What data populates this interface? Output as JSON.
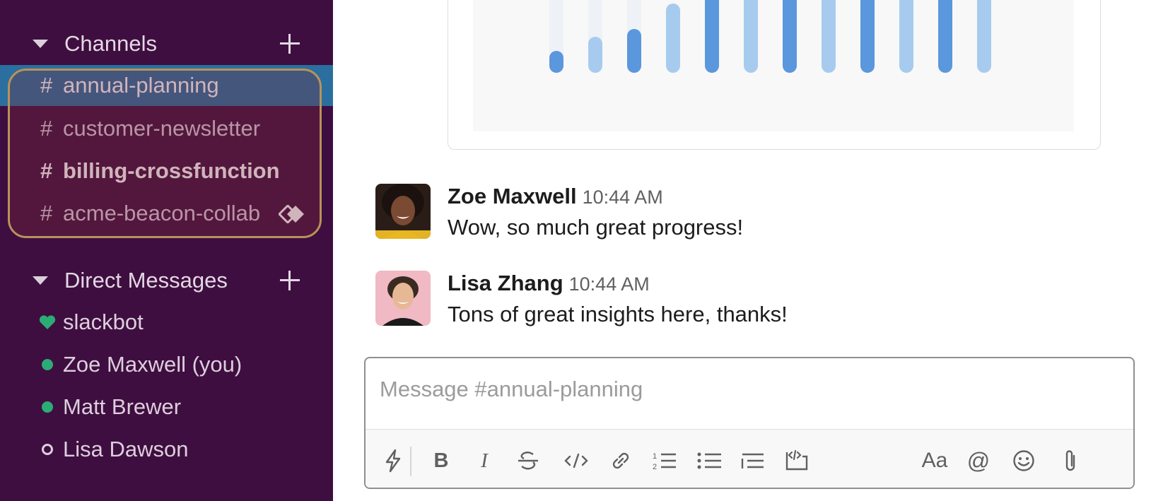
{
  "sidebar": {
    "channels_header": "Channels",
    "channels": [
      {
        "hash": "#",
        "name": "annual-planning",
        "active": true,
        "bold": false
      },
      {
        "hash": "#",
        "name": "customer-newsletter",
        "active": false,
        "bold": false
      },
      {
        "hash": "#",
        "name": "billing-crossfunction",
        "active": false,
        "bold": true
      },
      {
        "hash": "#",
        "name": "acme-beacon-collab",
        "active": false,
        "bold": false,
        "icon": "shared-channel-icon"
      }
    ],
    "dm_header": "Direct Messages",
    "dms": [
      {
        "label": "slackbot",
        "status": "heart-icon"
      },
      {
        "label": "Zoe Maxwell (you)",
        "status": "online"
      },
      {
        "label": "Matt Brewer",
        "status": "online"
      },
      {
        "label": "Lisa Dawson",
        "status": "away"
      }
    ]
  },
  "messages": [
    {
      "author": "Zoe Maxwell",
      "time": "10:44 AM",
      "text": "Wow, so much great progress!"
    },
    {
      "author": "Lisa Zhang",
      "time": "10:44 AM",
      "text": "Tons of great insights here, thanks!"
    }
  ],
  "composer": {
    "placeholder": "Message #annual-planning",
    "tools": [
      "shortcuts-icon",
      "bold-icon",
      "italic-icon",
      "strikethrough-icon",
      "code-icon",
      "link-icon",
      "ordered-list-icon",
      "bulleted-list-icon",
      "blockquote-icon",
      "code-block-icon",
      "formatting-icon",
      "mention-icon",
      "emoji-icon",
      "attachment-icon"
    ],
    "bold_glyph": "B",
    "italic_glyph": "I",
    "format_glyph": "Aa",
    "mention_glyph": "@"
  },
  "colors": {
    "sidebar_bg": "#3f0e40",
    "active_channel": "#2a6f9f",
    "presence_online": "#2bac76",
    "chart_dark": "#5b97dc",
    "chart_light": "#a7cbee"
  }
}
